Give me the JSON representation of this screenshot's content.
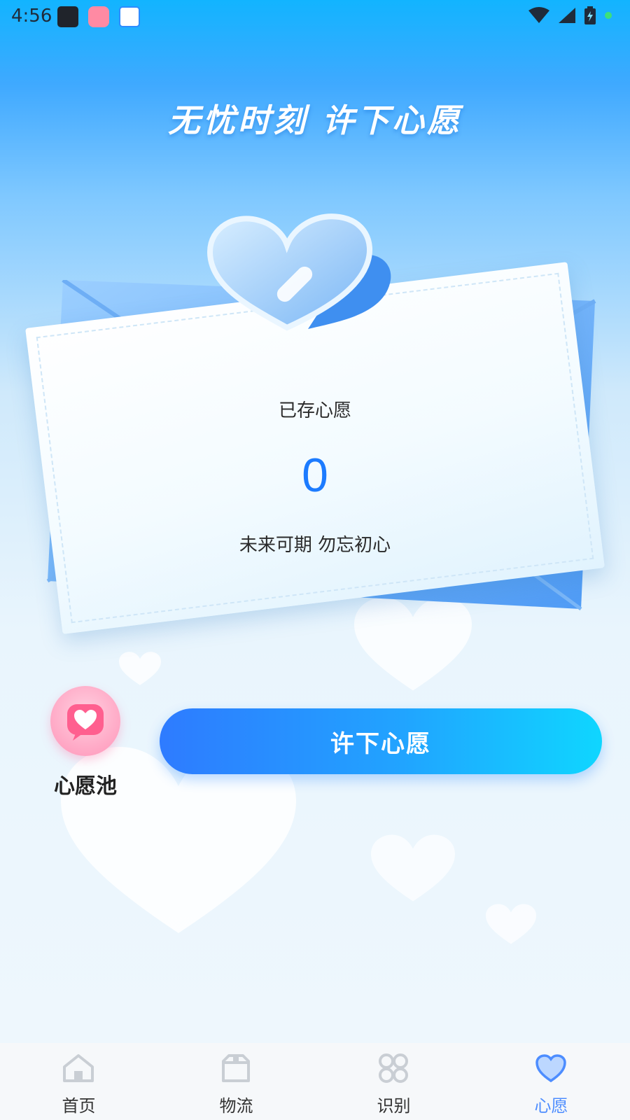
{
  "status_bar": {
    "time": "4:56"
  },
  "header": {
    "title": "无忧时刻 许下心愿"
  },
  "card": {
    "saved_label": "已存心愿",
    "count": "0",
    "slogan": "未来可期 勿忘初心"
  },
  "wish_pool": {
    "label": "心愿池",
    "icon": "heart-chat-icon"
  },
  "primary_action": {
    "label": "许下心愿"
  },
  "bottom_nav": {
    "items": [
      {
        "label": "首页",
        "icon": "home-icon"
      },
      {
        "label": "物流",
        "icon": "package-icon"
      },
      {
        "label": "识别",
        "icon": "scan-icon"
      },
      {
        "label": "心愿",
        "icon": "heart-icon",
        "active": true
      }
    ]
  },
  "colors": {
    "accent": "#1c7bff",
    "button_start": "#2e7bff",
    "button_end": "#0fd6ff",
    "pool_pink": "#ff93b8"
  }
}
